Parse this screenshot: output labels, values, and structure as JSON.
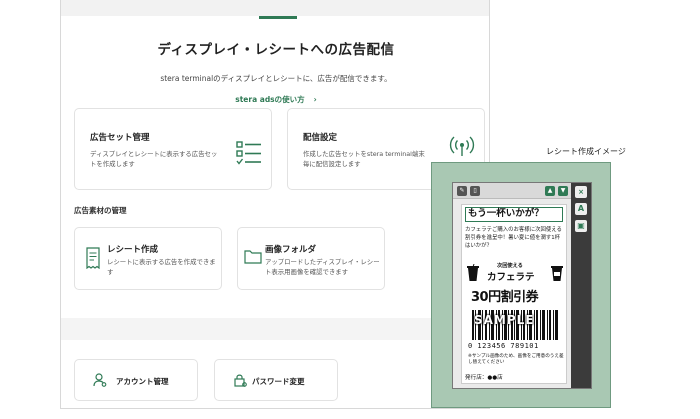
{
  "page": {
    "title": "ディスプレイ・レシートへの広告配信",
    "description": "stera terminalのディスプレイとレシートに、広告が配信できます。",
    "guide_link": "stera adsの使い方",
    "guide_chevron": "›"
  },
  "cards": {
    "adset": {
      "title": "広告セット管理",
      "desc": "ディスプレイとレシートに表示する広告セットを作成します",
      "icon": "list-check-icon"
    },
    "delivery": {
      "title": "配信設定",
      "desc": "作成した広告セットをstera terminal端末毎に配信設定します",
      "icon": "broadcast-icon"
    }
  },
  "section": {
    "label": "広告素材の管理"
  },
  "materials": {
    "receipt": {
      "title": "レシート作成",
      "desc": "レシートに表示する広告を作成できます",
      "icon": "receipt-icon"
    },
    "image_folder": {
      "title": "画像フォルダ",
      "desc": "アップロードしたディスプレイ・レシート表示用画像を確認できます",
      "icon": "folder-icon"
    }
  },
  "settings": {
    "account": {
      "title": "アカウント管理",
      "icon": "user-gear-icon"
    },
    "password": {
      "title": "パスワード変更",
      "icon": "lock-icon"
    }
  },
  "preview": {
    "label": "レシート作成イメージ",
    "headline": "もう一杯いかが？",
    "body": "カフェラテご購入のお客様に次回使える割引券を進呈中！暑い夏に値を潤す1杯はいかが？",
    "coupon_line1": "次回使える",
    "coupon_line2": "カフェラテ",
    "coupon_line3": "30円割引券",
    "barcode_watermark": "SAMPLE",
    "barcode_number": "0 123456 789101",
    "note": "※サンプル画像のため、画像をご用意のうえ差し替えてください",
    "issuer": "発行店：●●店",
    "side_text_tool": "A"
  },
  "colors": {
    "accent": "#2f7a55",
    "callout_fill": "#a9c8b3"
  }
}
